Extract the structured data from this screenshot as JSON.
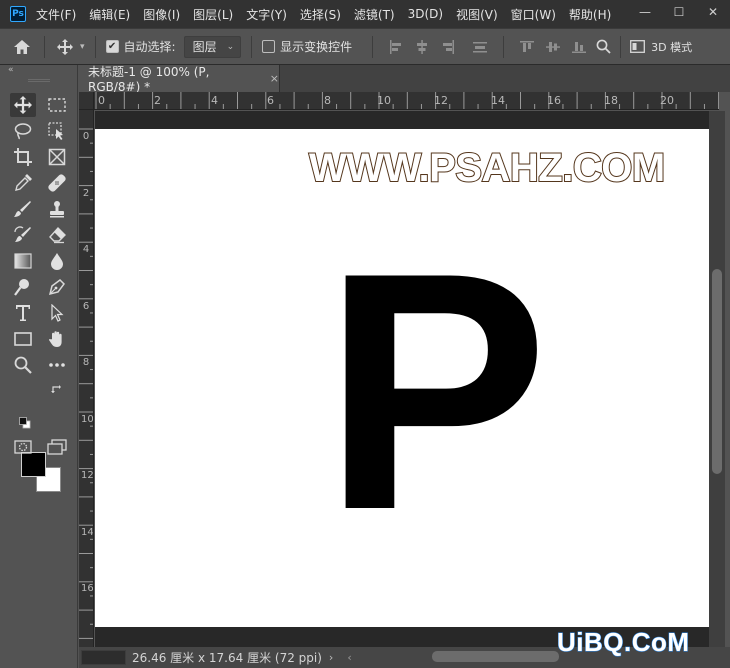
{
  "app": {
    "logo_text": "Ps",
    "menus": [
      "文件(F)",
      "编辑(E)",
      "图像(I)",
      "图层(L)",
      "文字(Y)",
      "选择(S)",
      "滤镜(T)",
      "3D(D)",
      "视图(V)",
      "窗口(W)",
      "帮助(H)"
    ],
    "window_controls": {
      "minimize": "—",
      "maximize": "☐",
      "close": "✕"
    }
  },
  "options_bar": {
    "auto_select_label": "自动选择:",
    "auto_select_checked": true,
    "auto_select_target": "图层",
    "show_transform_label": "显示变换控件",
    "show_transform_checked": false,
    "mode_3d_label": "3D 模式"
  },
  "document": {
    "tab_title": "未标题-1 @ 100% (P, RGB/8#) *",
    "tab_close": "×",
    "ruler_top_labels": [
      "0",
      "2",
      "4",
      "6",
      "8",
      "10",
      "12",
      "14",
      "16",
      "18",
      "20"
    ],
    "ruler_left_labels": [
      "0",
      "2",
      "4",
      "6",
      "8",
      "10",
      "12",
      "14",
      "16"
    ],
    "canvas_watermark": "WWW.PSAHZ.COM",
    "canvas_letter": "P",
    "status_text": "26.46 厘米 x 17.64 厘米 (72 ppi)",
    "status_arrow": "›",
    "status_left_arrow": "‹"
  },
  "colors": {
    "foreground": "#000000",
    "background": "#ffffff",
    "accent": "#31a8ff"
  },
  "site_mark": "UiBQ.CoM"
}
